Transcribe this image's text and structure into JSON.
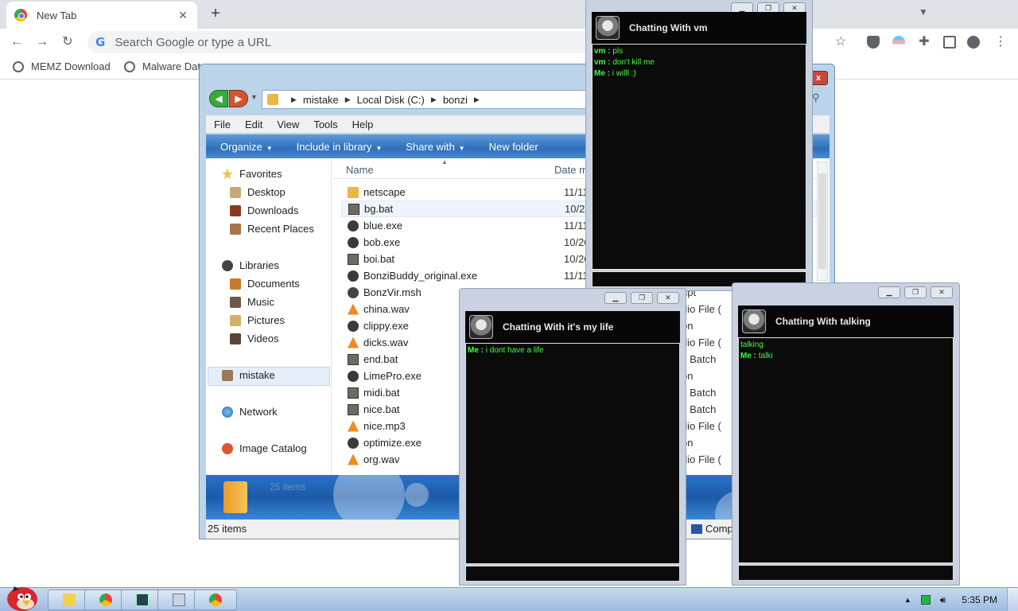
{
  "browser": {
    "tab_title": "New Tab",
    "tab_close": "✕",
    "new_tab": "+",
    "omnibox_placeholder": "Search Google or type a URL",
    "bookmarks": [
      {
        "label": "MEMZ Download"
      },
      {
        "label": "Malware Dat"
      }
    ]
  },
  "explorer": {
    "close": "x",
    "breadcrumb": [
      "mistake",
      "Local Disk (C:)",
      "bonzi"
    ],
    "menu": [
      "File",
      "Edit",
      "View",
      "Tools",
      "Help"
    ],
    "commands": [
      "Organize",
      "Include in library",
      "Share with",
      "New folder"
    ],
    "nav": {
      "favorites": "Favorites",
      "desktop": "Desktop",
      "downloads": "Downloads",
      "recent": "Recent Places",
      "libraries": "Libraries",
      "documents": "Documents",
      "music": "Music",
      "pictures": "Pictures",
      "videos": "Videos",
      "mistake": "mistake",
      "network": "Network",
      "image_catalog": "Image Catalog"
    },
    "columns": {
      "name": "Name",
      "date": "Date m"
    },
    "files": [
      {
        "name": "netscape",
        "date": "11/11/",
        "type": ""
      },
      {
        "name": "bg.bat",
        "date": "10/26/",
        "type": ""
      },
      {
        "name": "blue.exe",
        "date": "11/11/",
        "type": ""
      },
      {
        "name": "bob.exe",
        "date": "10/26/",
        "type": ""
      },
      {
        "name": "boi.bat",
        "date": "10/26/",
        "type": ""
      },
      {
        "name": "BonziBuddy_original.exe",
        "date": "11/11/",
        "type": ""
      },
      {
        "name": "BonzVir.msh",
        "date": "",
        "type": "ript"
      },
      {
        "name": "china.wav",
        "date": "",
        "type": "dio File ("
      },
      {
        "name": "clippy.exe",
        "date": "",
        "type": "on"
      },
      {
        "name": "dicks.wav",
        "date": "",
        "type": "dio File ("
      },
      {
        "name": "end.bat",
        "date": "",
        "type": "s Batch"
      },
      {
        "name": "LimePro.exe",
        "date": "",
        "type": "on"
      },
      {
        "name": "midi.bat",
        "date": "",
        "type": "s Batch"
      },
      {
        "name": "nice.bat",
        "date": "",
        "type": "s Batch"
      },
      {
        "name": "nice.mp3",
        "date": "",
        "type": "dio File ("
      },
      {
        "name": "optimize.exe",
        "date": "",
        "type": "on"
      },
      {
        "name": "org.wav",
        "date": "",
        "type": "dio File ("
      }
    ],
    "details_count": "25 items",
    "status_count": "25 items",
    "status_computer": "Comp"
  },
  "chats": {
    "vm": {
      "title": "Chatting With vm",
      "messages": [
        {
          "sender": "vm :",
          "text": "pls"
        },
        {
          "sender": "vm :",
          "text": "don't kill me"
        },
        {
          "sender": "Me :",
          "text": "i willl :)"
        }
      ]
    },
    "life": {
      "title": "Chatting With it's my life",
      "messages": [
        {
          "sender": "Me :",
          "text": "i dont have a life"
        }
      ]
    },
    "talking": {
      "title": "Chatting With talking",
      "messages": [
        {
          "sender": "",
          "text": "talking"
        },
        {
          "sender": "Me :",
          "text": "talki"
        }
      ]
    }
  },
  "taskbar": {
    "clock": "5:35 PM"
  },
  "colors": {
    "chat_text": "#3cff3c",
    "command_bar": "#2d6fba"
  }
}
